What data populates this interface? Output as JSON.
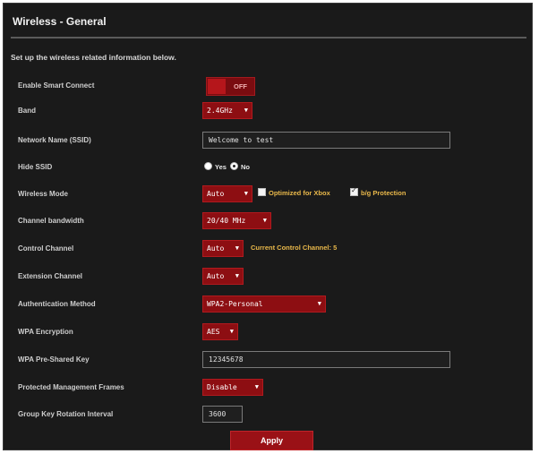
{
  "header": {
    "title": "Wireless - General",
    "description": "Set up the wireless related information below."
  },
  "fields": {
    "smart_connect": {
      "label": "Enable Smart Connect",
      "state": "OFF"
    },
    "band": {
      "label": "Band",
      "value": "2.4GHz"
    },
    "ssid": {
      "label": "Network Name (SSID)",
      "value": "Welcome to test"
    },
    "hide_ssid": {
      "label": "Hide SSID",
      "yes": "Yes",
      "no": "No",
      "selected": "No"
    },
    "wireless_mode": {
      "label": "Wireless Mode",
      "value": "Auto",
      "optimize_label": "Optimized for Xbox",
      "bg_label": "b/g Protection"
    },
    "channel_bandwidth": {
      "label": "Channel bandwidth",
      "value": "20/40 MHz"
    },
    "control_channel": {
      "label": "Control Channel",
      "value": "Auto",
      "current": "Current Control Channel: 5"
    },
    "extension_channel": {
      "label": "Extension Channel",
      "value": "Auto"
    },
    "auth_method": {
      "label": "Authentication Method",
      "value": "WPA2-Personal"
    },
    "wpa_encryption": {
      "label": "WPA Encryption",
      "value": "AES"
    },
    "wpa_key": {
      "label": "WPA Pre-Shared Key",
      "value": "12345678"
    },
    "pmf": {
      "label": "Protected Management Frames",
      "value": "Disable"
    },
    "group_key": {
      "label": "Group Key Rotation Interval",
      "value": "3600"
    }
  },
  "actions": {
    "apply_label": "Apply"
  },
  "colors": {
    "accent": "#9a1116",
    "background": "#1a1a1a",
    "hint": "#e9b84a"
  }
}
